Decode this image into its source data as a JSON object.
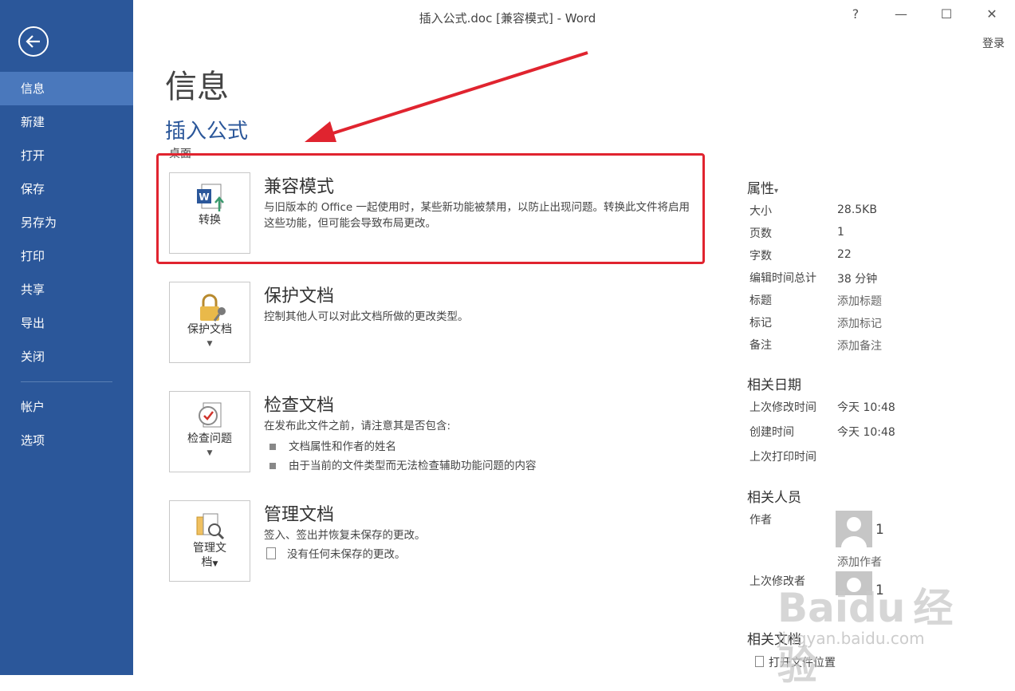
{
  "window": {
    "title": "插入公式.doc [兼容模式] - Word",
    "help": "?",
    "minimize": "—",
    "maximize": "☐",
    "close": "✕",
    "signin": "登录"
  },
  "sidebar": {
    "items": [
      {
        "label": "信息"
      },
      {
        "label": "新建"
      },
      {
        "label": "打开"
      },
      {
        "label": "保存"
      },
      {
        "label": "另存为"
      },
      {
        "label": "打印"
      },
      {
        "label": "共享"
      },
      {
        "label": "导出"
      },
      {
        "label": "关闭"
      }
    ],
    "bottom_items": [
      {
        "label": "帐户"
      },
      {
        "label": "选项"
      }
    ]
  },
  "main": {
    "page_title": "信息",
    "doc_name": "插入公式",
    "doc_location": "桌面",
    "sections": [
      {
        "tile_label": "转换",
        "title": "兼容模式",
        "desc": "与旧版本的 Office 一起使用时，某些新功能被禁用，以防止出现问题。转换此文件将启用这些功能，但可能会导致布局更改。"
      },
      {
        "tile_label": "保护文档",
        "title": "保护文档",
        "desc": "控制其他人可以对此文档所做的更改类型。"
      },
      {
        "tile_label": "检查问题",
        "title": "检查文档",
        "desc": "在发布此文件之前，请注意其是否包含:",
        "bullets": [
          "文档属性和作者的姓名",
          "由于当前的文件类型而无法检查辅助功能问题的内容"
        ]
      },
      {
        "tile_label_1": "管理文",
        "tile_label_2": "档",
        "title": "管理文档",
        "desc": "签入、签出并恢复未保存的更改。",
        "note": "没有任何未保存的更改。"
      }
    ]
  },
  "properties": {
    "header": "属性",
    "rows": [
      {
        "key": "大小",
        "value": "28.5KB"
      },
      {
        "key": "页数",
        "value": "1"
      },
      {
        "key": "字数",
        "value": "22"
      },
      {
        "key": "编辑时间总计",
        "value": "38 分钟"
      },
      {
        "key": "标题",
        "value": "添加标题"
      },
      {
        "key": "标记",
        "value": "添加标记"
      },
      {
        "key": "备注",
        "value": "添加备注"
      }
    ],
    "dates_header": "相关日期",
    "dates": [
      {
        "key": "上次修改时间",
        "value": "今天 10:48"
      },
      {
        "key": "创建时间",
        "value": "今天 10:48"
      },
      {
        "key": "上次打印时间",
        "value": ""
      }
    ],
    "people_header": "相关人员",
    "author_label": "作者",
    "author_name": "1",
    "add_author": "添加作者",
    "last_modified_by_label": "上次修改者",
    "last_modified_by_name": "1",
    "docs_header": "相关文档",
    "open_location": "打开文件位置"
  },
  "watermark": {
    "brand": "Baidu",
    "brand_cn": "经验",
    "url": "jingyan.baidu.com"
  },
  "colors": {
    "sidebar": "#2b579a",
    "sidebar_active": "#4a78bc",
    "accent": "#2b579a",
    "highlight": "#e0242f"
  }
}
